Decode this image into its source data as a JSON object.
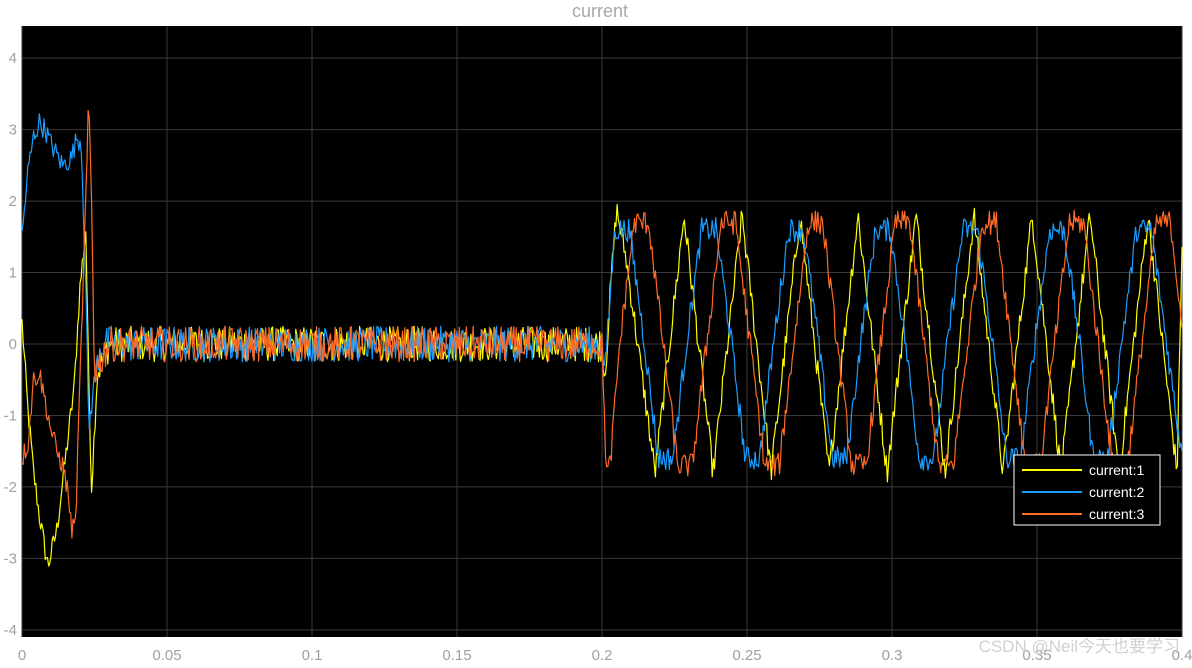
{
  "watermark": "CSDN @Neil今天也要学习",
  "chart_data": {
    "type": "line",
    "title": "current",
    "xlabel": "",
    "ylabel": "",
    "xlim": [
      0,
      0.4
    ],
    "ylim": [
      -4.1,
      4.45
    ],
    "xticks": [
      0,
      0.05,
      0.1,
      0.15,
      0.2,
      0.25,
      0.3,
      0.35,
      0.4
    ],
    "xtick_labels": [
      "0",
      "0.05",
      "0.1",
      "0.15",
      "0.2",
      "0.25",
      "0.3",
      "0.35",
      "0.4"
    ],
    "yticks": [
      -4,
      -3,
      -2,
      -1,
      0,
      1,
      2,
      3,
      4
    ],
    "ytick_labels": [
      "-4",
      "-3",
      "-2",
      "-1",
      "0",
      "1",
      "2",
      "3",
      "4"
    ],
    "grid": true,
    "background": "#000000",
    "grid_color": "#3a3a3a",
    "legend_position": "lower-right",
    "series": [
      {
        "name": "current:1",
        "color": "#ffff00",
        "x": [
          0,
          0.002,
          0.004,
          0.006,
          0.008,
          0.009,
          0.012,
          0.015,
          0.018,
          0.02,
          0.022,
          0.023,
          0.024,
          0.026,
          0.03,
          0.2,
          0.201,
          0.203,
          0.205,
          0.2083,
          0.2183,
          0.2283,
          0.2383,
          0.2483,
          0.2583,
          0.2683,
          0.2783,
          0.2883,
          0.2983,
          0.3083,
          0.3183,
          0.3283,
          0.3383,
          0.3483,
          0.3583,
          0.3683,
          0.3783,
          0.3883,
          0.3983,
          0.4
        ],
        "y": [
          0.3,
          -0.9,
          -1.8,
          -2.4,
          -2.9,
          -3.1,
          -2.6,
          -1.6,
          -0.6,
          0.8,
          1.6,
          -0.5,
          -2.0,
          -0.4,
          0.0,
          0.0,
          -0.5,
          0.8,
          1.9,
          1.2,
          -1.8,
          1.8,
          -1.8,
          1.8,
          -1.8,
          1.8,
          -1.8,
          1.8,
          -1.8,
          1.8,
          -1.8,
          1.8,
          -1.8,
          1.8,
          -1.8,
          1.8,
          -1.8,
          1.8,
          -1.8,
          1.4
        ]
      },
      {
        "name": "current:2",
        "color": "#1a9dff",
        "x": [
          0,
          0.002,
          0.004,
          0.006,
          0.008,
          0.01,
          0.014,
          0.017,
          0.019,
          0.0205,
          0.022,
          0.023,
          0.025,
          0.027,
          0.03,
          0.2,
          0.201,
          0.2044,
          0.2094,
          0.2144,
          0.2194,
          0.2244,
          0.2294,
          0.2344,
          0.2394,
          0.2444,
          0.2494,
          0.2544,
          0.2594,
          0.2644,
          0.2694,
          0.2744,
          0.2794,
          0.2844,
          0.2894,
          0.2944,
          0.2994,
          0.3044,
          0.3094,
          0.3144,
          0.3194,
          0.3244,
          0.3294,
          0.3344,
          0.3394,
          0.3444,
          0.3494,
          0.3544,
          0.3594,
          0.3644,
          0.3694,
          0.3744,
          0.3794,
          0.3844,
          0.3894,
          0.3944,
          0.3994,
          0.4
        ],
        "y": [
          1.5,
          2.4,
          2.9,
          3.1,
          3.0,
          2.8,
          2.5,
          2.6,
          2.9,
          2.8,
          0.8,
          -1.2,
          -0.5,
          0.0,
          0.0,
          0.0,
          -0.4,
          1.6,
          1.6,
          0.1,
          -1.6,
          -1.6,
          0.1,
          1.6,
          1.6,
          0.1,
          -1.6,
          -1.6,
          0.1,
          1.6,
          1.6,
          0.1,
          -1.6,
          -1.6,
          0.1,
          1.6,
          1.6,
          0.1,
          -1.6,
          -1.6,
          0.1,
          1.6,
          1.6,
          0.1,
          -1.6,
          -1.6,
          0.1,
          1.6,
          1.6,
          0.1,
          -1.6,
          -1.6,
          0.1,
          1.6,
          1.6,
          0.1,
          -1.4,
          -1.4
        ]
      },
      {
        "name": "current:3",
        "color": "#ff6a26",
        "x": [
          0,
          0.002,
          0.004,
          0.006,
          0.008,
          0.01,
          0.012,
          0.014,
          0.016,
          0.017,
          0.0185,
          0.02,
          0.022,
          0.023,
          0.024,
          0.025,
          0.026,
          0.03,
          0.2,
          0.2005,
          0.2015,
          0.2028,
          0.2061,
          0.2111,
          0.2161,
          0.2211,
          0.2261,
          0.2311,
          0.2361,
          0.2411,
          0.2461,
          0.2511,
          0.2561,
          0.2611,
          0.2661,
          0.2711,
          0.2761,
          0.2811,
          0.2861,
          0.2911,
          0.2961,
          0.3011,
          0.3061,
          0.3111,
          0.3161,
          0.3211,
          0.3261,
          0.3311,
          0.3361,
          0.3411,
          0.3461,
          0.3511,
          0.3561,
          0.3611,
          0.3661,
          0.3711,
          0.3761,
          0.3811,
          0.3861,
          0.3911,
          0.3961,
          0.4
        ],
        "y": [
          -1.6,
          -1.4,
          -0.5,
          -0.4,
          -0.8,
          -1.2,
          -1.5,
          -1.7,
          -2.1,
          -2.6,
          -2.5,
          -0.5,
          2.0,
          3.4,
          2.0,
          -0.5,
          -0.3,
          0.0,
          0.0,
          -0.6,
          -1.8,
          -1.7,
          0.0,
          1.7,
          1.7,
          0.0,
          -1.7,
          -1.7,
          0.0,
          1.7,
          1.7,
          0.0,
          -1.7,
          -1.7,
          0.0,
          1.7,
          1.7,
          0.0,
          -1.7,
          -1.7,
          0.0,
          1.7,
          1.7,
          0.0,
          -1.7,
          -1.7,
          0.0,
          1.7,
          1.7,
          0.0,
          -1.7,
          -1.7,
          0.0,
          1.7,
          1.7,
          0.0,
          -1.7,
          -1.7,
          0.0,
          1.7,
          1.7,
          0.3
        ]
      }
    ]
  }
}
